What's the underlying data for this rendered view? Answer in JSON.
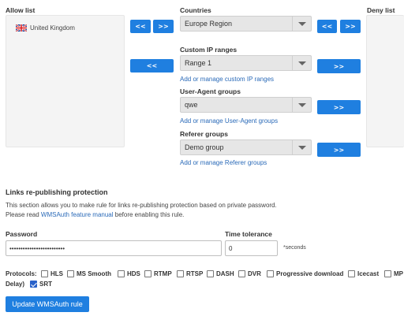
{
  "allow_list": {
    "title": "Allow list",
    "items": [
      {
        "flag": "uk-flag-icon",
        "label": "United Kingdom"
      }
    ]
  },
  "deny_list": {
    "title": "Deny list"
  },
  "countries": {
    "label": "Countries",
    "selected": "Europe Region"
  },
  "custom_ip": {
    "label": "Custom IP ranges",
    "selected": "Range 1",
    "manage_link": "Add or manage custom IP ranges"
  },
  "user_agent": {
    "label": "User-Agent groups",
    "selected": "qwe",
    "manage_link": "Add or manage User-Agent groups"
  },
  "referer": {
    "label": "Referer groups",
    "selected": "Demo group",
    "manage_link": "Add or manage Referer groups"
  },
  "buttons": {
    "move_left": "<<",
    "move_right": ">>"
  },
  "protection": {
    "title": "Links re-publishing protection",
    "desc1": "This section allows you to make rule for links re-publishing protection based on private password.",
    "desc2_prefix": "Please read ",
    "desc2_link": "WMSAuth feature manual",
    "desc2_suffix": " before enabling this rule."
  },
  "password": {
    "label": "Password",
    "value": "•••••••••••••••••••••••••"
  },
  "time_tolerance": {
    "label": "Time tolerance",
    "value": "0",
    "unit": "*seconds"
  },
  "protocols": {
    "label": "Protocols:",
    "items": [
      {
        "label": "HLS",
        "checked": false
      },
      {
        "label": "MS Smooth",
        "checked": false
      },
      {
        "label": "HDS",
        "checked": false
      },
      {
        "label": "RTMP",
        "checked": false
      },
      {
        "label": "RTSP",
        "checked": false
      },
      {
        "label": "DASH",
        "checked": false
      },
      {
        "label": "DVR",
        "checked": false
      },
      {
        "label": "Progressive download",
        "checked": false
      },
      {
        "label": "Icecast",
        "checked": false
      },
      {
        "label": "MP",
        "checked": false
      }
    ],
    "wrap_text": "Delay)",
    "srt": {
      "label": "SRT",
      "checked": true
    }
  },
  "submit_label": "Update WMSAuth rule"
}
